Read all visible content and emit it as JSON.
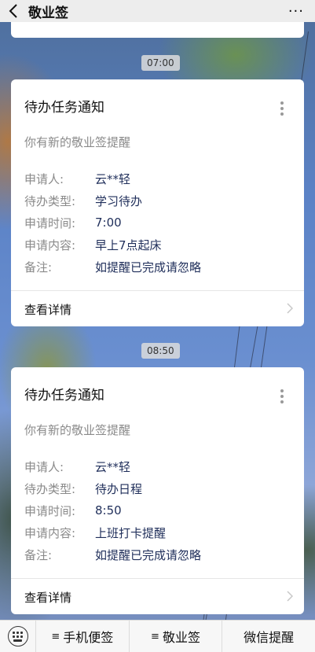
{
  "header": {
    "title": "敬业签",
    "back_icon": "chevron-left-icon",
    "more_label": "···"
  },
  "messages": [
    {
      "time": "07:00",
      "title": "待办任务通知",
      "subtitle": "你有新的敬业签提醒",
      "fields": [
        {
          "label": "申请人:",
          "value": "云**轻"
        },
        {
          "label": "待办类型:",
          "value": "学习待办"
        },
        {
          "label": "申请时间:",
          "value": "7:00"
        },
        {
          "label": "申请内容:",
          "value": "早上7点起床"
        },
        {
          "label": "备注:",
          "value": "如提醒已完成请忽略"
        }
      ],
      "link_label": "查看详情"
    },
    {
      "time": "08:50",
      "title": "待办任务通知",
      "subtitle": "你有新的敬业签提醒",
      "fields": [
        {
          "label": "申请人:",
          "value": "云**轻"
        },
        {
          "label": "待办类型:",
          "value": "待办日程"
        },
        {
          "label": "申请时间:",
          "value": "8:50"
        },
        {
          "label": "申请内容:",
          "value": "上班打卡提醒"
        },
        {
          "label": "备注:",
          "value": "如提醒已完成请忽略"
        }
      ],
      "link_label": "查看详情"
    }
  ],
  "bottom_bar": {
    "keyboard_icon": "keyboard-icon",
    "tabs": [
      {
        "icon": "≡",
        "label": "手机便签"
      },
      {
        "icon": "≡",
        "label": "敬业签"
      },
      {
        "icon": "",
        "label": "微信提醒"
      }
    ]
  }
}
